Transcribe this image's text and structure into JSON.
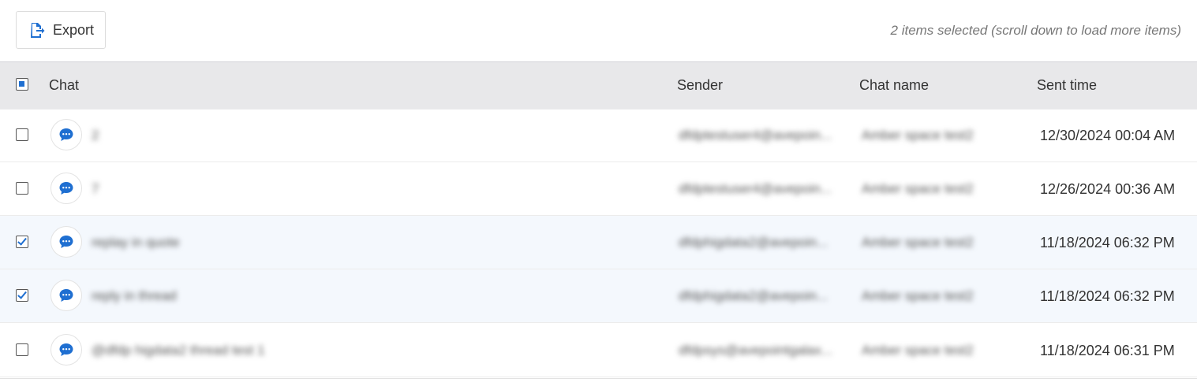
{
  "toolbar": {
    "export_label": "Export",
    "export_icon": "file-export-icon",
    "selection_status": "2 items selected (scroll down to load more items)"
  },
  "table": {
    "columns": {
      "chat": "Chat",
      "sender": "Sender",
      "chat_name": "Chat name",
      "sent_time": "Sent time"
    },
    "select_all_state": "indeterminate",
    "rows": [
      {
        "selected": false,
        "chat": "2",
        "sender": "dfdptestuser4@avepoin...",
        "chat_name": "Amber space test2",
        "sent_time": "12/30/2024 00:04 AM"
      },
      {
        "selected": false,
        "chat": "7",
        "sender": "dfdptestuser4@avepoin...",
        "chat_name": "Amber space test2",
        "sent_time": "12/26/2024 00:36 AM"
      },
      {
        "selected": true,
        "chat": "replay in quote",
        "sender": "dfdphigdata2@avepoin...",
        "chat_name": "Amber space test2",
        "sent_time": "11/18/2024 06:32 PM"
      },
      {
        "selected": true,
        "chat": "reply in thread",
        "sender": "dfdphigdata2@avepoin...",
        "chat_name": "Amber space test2",
        "sent_time": "11/18/2024 06:32 PM"
      },
      {
        "selected": false,
        "chat": "@dfdp higdata2 thread test 1",
        "sender": "dfdpsys@avepointgalax...",
        "chat_name": "Amber space test2",
        "sent_time": "11/18/2024 06:31 PM"
      }
    ]
  },
  "colors": {
    "accent": "#1f6fd1",
    "header_bg": "#e8e8ea",
    "selected_row_bg": "#f4f8fd"
  }
}
